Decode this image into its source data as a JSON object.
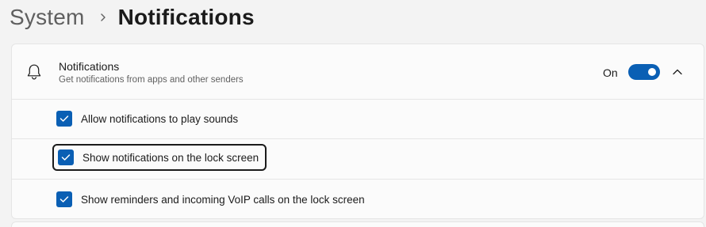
{
  "breadcrumb": {
    "parent": "System",
    "separator_icon": "chevron-right-icon",
    "current": "Notifications"
  },
  "notifications_section": {
    "icon": "bell-icon",
    "title": "Notifications",
    "description": "Get notifications from apps and other senders",
    "toggle_state_label": "On",
    "toggle_on": true,
    "expanded": true,
    "expand_icon": "chevron-up-icon",
    "options": [
      {
        "label": "Allow notifications to play sounds",
        "checked": true,
        "focused": false
      },
      {
        "label": "Show notifications on the lock screen",
        "checked": true,
        "focused": true
      },
      {
        "label": "Show reminders and incoming VoIP calls on the lock screen",
        "checked": true,
        "focused": false
      }
    ]
  },
  "colors": {
    "accent": "#0a5fb4",
    "background": "#f3f3f3",
    "card": "#fbfbfb"
  }
}
